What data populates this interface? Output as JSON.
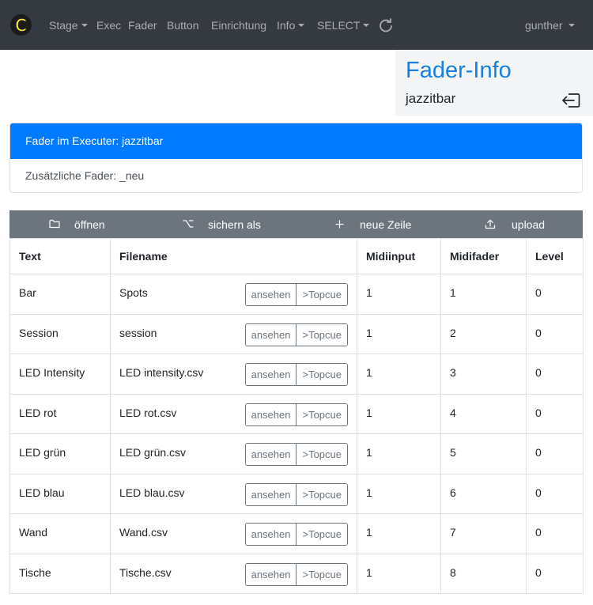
{
  "brand": {
    "logo_glyph": "C",
    "logo_color": "#ffeb3b"
  },
  "nav": {
    "items": [
      {
        "label": "Stage",
        "dropdown": true
      },
      {
        "label": "Exec",
        "dropdown": false
      },
      {
        "label": "Fader",
        "dropdown": false
      },
      {
        "label": "Button",
        "dropdown": false
      },
      {
        "label": "Einrichtung",
        "dropdown": false
      },
      {
        "label": "Info",
        "dropdown": true
      },
      {
        "label": "SELECT",
        "dropdown": true
      }
    ],
    "reload_icon": "reload-icon",
    "user": "gunther"
  },
  "info": {
    "title": "Fader-Info",
    "subtitle": "jazzitbar",
    "logout_icon": "logout-icon"
  },
  "list": {
    "active": "Fader im Executer: jazzitbar",
    "item": "Zusätzliche Fader: _neu"
  },
  "toolbar": {
    "open": {
      "label": "öffnen",
      "icon": "folder-icon"
    },
    "save_as": {
      "label": "sichern als",
      "icon": "option-key-icon"
    },
    "new_row": {
      "label": "neue Zeile",
      "icon": "plus-icon"
    },
    "upload": {
      "label": "upload",
      "icon": "upload-icon"
    }
  },
  "table": {
    "headers": [
      "Text",
      "Filename",
      "Midiinput",
      "Midifader",
      "Level"
    ],
    "view_button": "ansehen",
    "topcue_button": ">Topcue",
    "rows": [
      {
        "text": "Bar",
        "filename": "Spots",
        "midiinput": "1",
        "midifader": "1",
        "level": "0"
      },
      {
        "text": "Session",
        "filename": "session",
        "midiinput": "1",
        "midifader": "2",
        "level": "0"
      },
      {
        "text": "LED Intensity",
        "filename": "LED intensity.csv",
        "midiinput": "1",
        "midifader": "3",
        "level": "0"
      },
      {
        "text": "LED rot",
        "filename": "LED rot.csv",
        "midiinput": "1",
        "midifader": "4",
        "level": "0"
      },
      {
        "text": "LED grün",
        "filename": "LED grün.csv",
        "midiinput": "1",
        "midifader": "5",
        "level": "0"
      },
      {
        "text": "LED blau",
        "filename": "LED blau.csv",
        "midiinput": "1",
        "midifader": "6",
        "level": "0"
      },
      {
        "text": "Wand",
        "filename": "Wand.csv",
        "midiinput": "1",
        "midifader": "7",
        "level": "0"
      },
      {
        "text": "Tische",
        "filename": "Tische.csv",
        "midiinput": "1",
        "midifader": "8",
        "level": "0"
      }
    ]
  },
  "colors": {
    "navbar": "#343a40",
    "accent": "#007bff",
    "toolbar": "#6c757d",
    "title": "#1a80e0"
  }
}
